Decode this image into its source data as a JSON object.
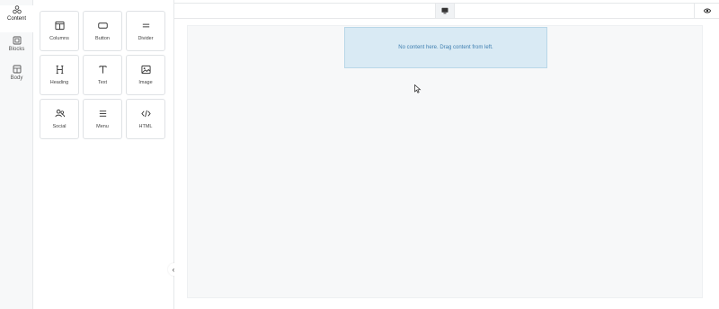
{
  "rail": {
    "tabs": [
      {
        "label": "Content",
        "icon": "content-icon",
        "active": true
      },
      {
        "label": "Blocks",
        "icon": "blocks-icon",
        "active": false
      },
      {
        "label": "Body",
        "icon": "body-icon",
        "active": false
      }
    ]
  },
  "tools": [
    {
      "label": "Columns",
      "icon": "columns-icon"
    },
    {
      "label": "Button",
      "icon": "button-icon"
    },
    {
      "label": "Divider",
      "icon": "divider-icon"
    },
    {
      "label": "Heading",
      "icon": "heading-icon"
    },
    {
      "label": "Text",
      "icon": "text-icon"
    },
    {
      "label": "Image",
      "icon": "image-icon"
    },
    {
      "label": "Social",
      "icon": "social-icon"
    },
    {
      "label": "Menu",
      "icon": "menu-icon"
    },
    {
      "label": "HTML",
      "icon": "html-icon"
    }
  ],
  "canvas": {
    "empty_message": "No content here. Drag content from left."
  },
  "colors": {
    "dropzone_bg": "#d9eaf4",
    "dropzone_text": "#3f7fb0",
    "canvas_bg": "#f7f8f9"
  }
}
